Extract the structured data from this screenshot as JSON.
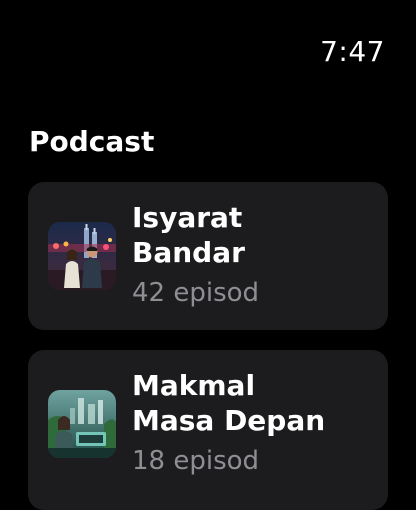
{
  "status": {
    "time": "7:47"
  },
  "section": {
    "title": "Podcast"
  },
  "podcasts": [
    {
      "title_line1": "Isyarat",
      "title_line2": "Bandar",
      "episodes": "42 episod",
      "artwork_icon": "city-night-couple-artwork"
    },
    {
      "title_line1": "Makmal",
      "title_line2": "Masa Depan",
      "episodes": "18 episod",
      "artwork_icon": "future-lab-woman-artwork"
    }
  ],
  "colors": {
    "background": "#000000",
    "card": "#1c1c1e",
    "primary_text": "#ffffff",
    "secondary_text": "#8e8e93"
  }
}
